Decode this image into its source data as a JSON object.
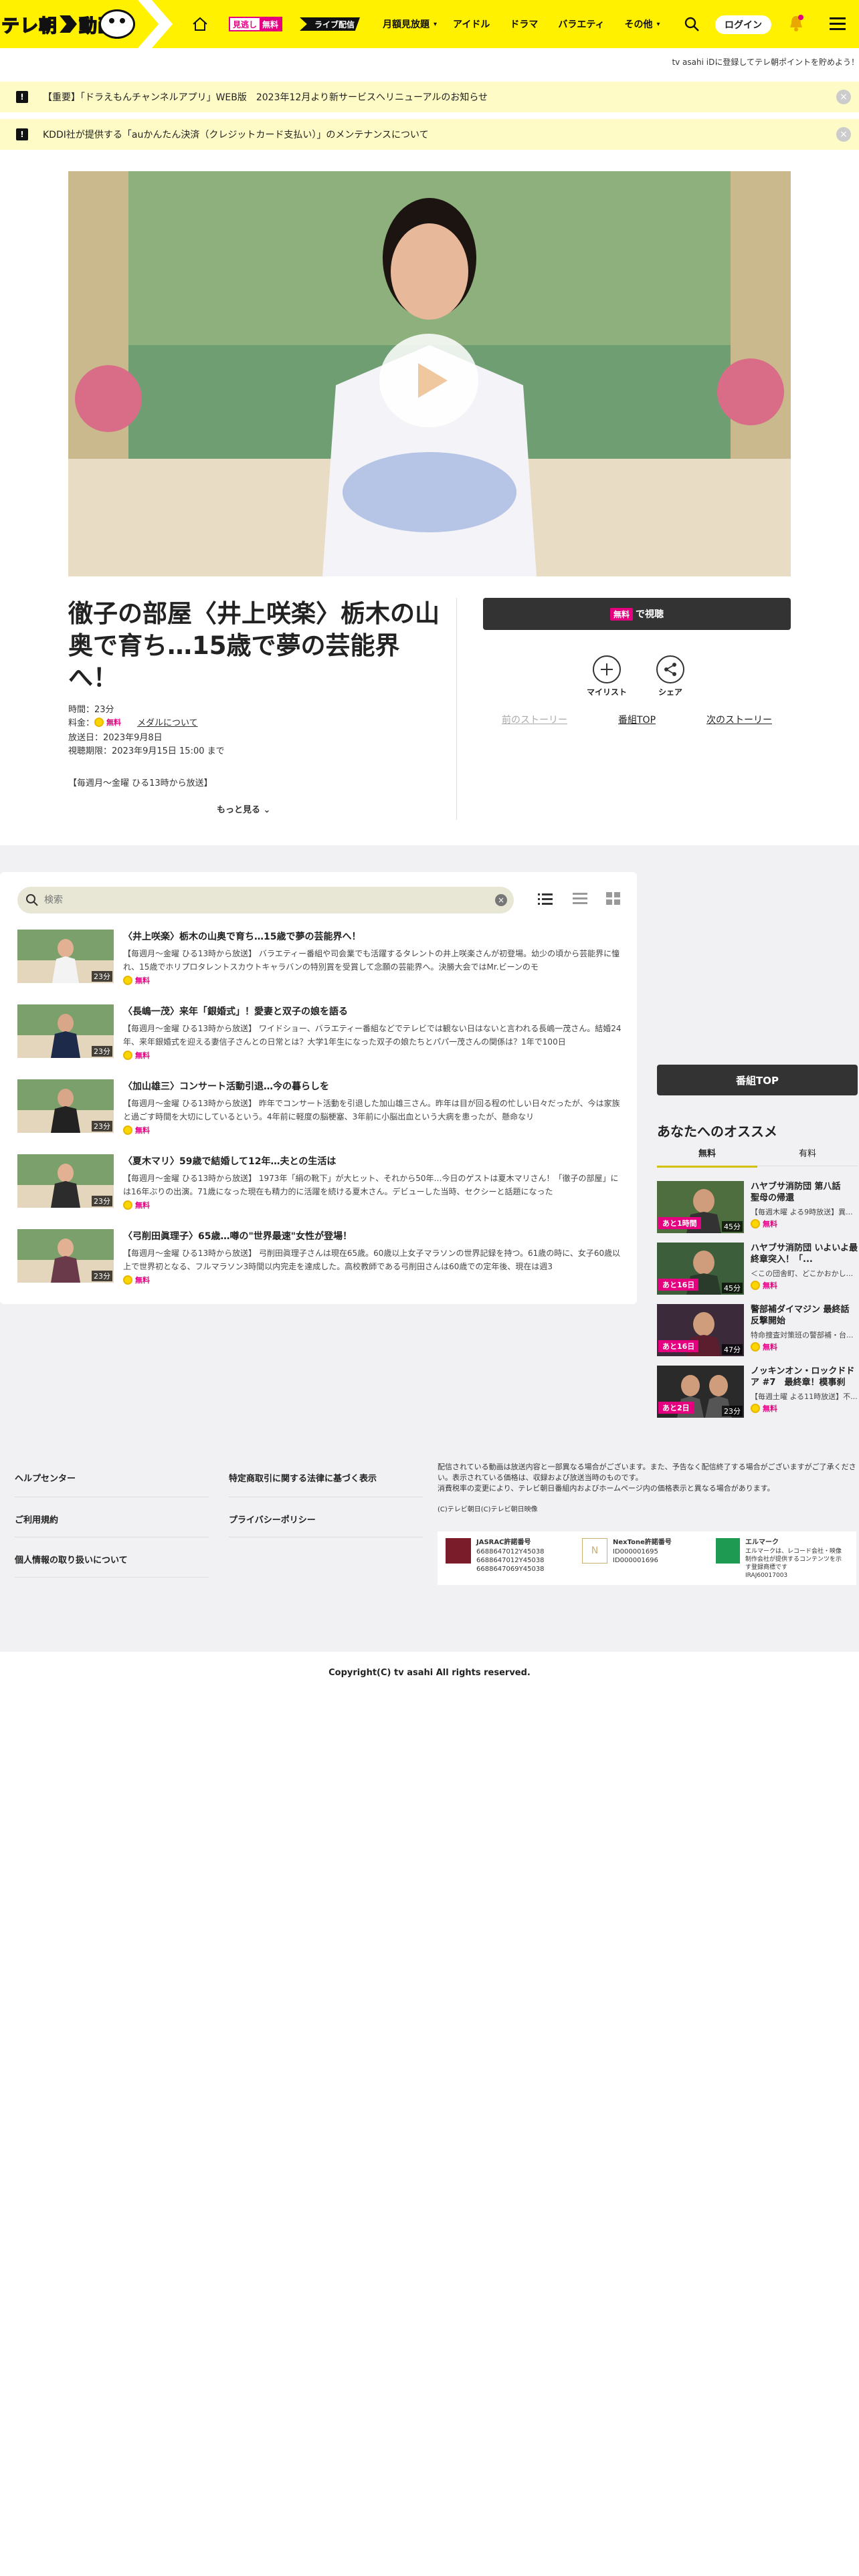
{
  "header": {
    "logo_text": "テレ朝",
    "logo_text2": "動画",
    "mi_a": "見逃し",
    "mi_b": "無料",
    "live": "ライブ配信",
    "nav": [
      "月額見放題",
      "アイドル",
      "ドラマ",
      "バラエティ",
      "その他"
    ],
    "login": "ログイン"
  },
  "promo": "tv asahi iDに登録してテレ朝ポイントを貯めよう！",
  "notices": [
    "【重要】「ドラえもんチャンネルアプリ」WEB版　2023年12月より新サービスへリニューアルのお知らせ",
    "KDDI社が提供する「auかんたん決済（クレジットカード支払い）」のメンテナンスについて"
  ],
  "program": {
    "title": "徹子の部屋〈井上咲楽〉栃木の山奥で育ち…15歳で夢の芸能界へ！",
    "time": "時間：23分",
    "fee_label": "料金：",
    "fee_free": "無料",
    "medal": "メダルについて",
    "air": "放送日：2023年9月8日",
    "deadline": "視聴期限：2023年9月15日 15:00 まで",
    "slot": "【毎週月〜金曜 ひる13時から放送】",
    "more": "もっと見る"
  },
  "actions": {
    "watch_badge": "無料",
    "watch_label": "で視聴",
    "mylist": "マイリスト",
    "share": "シェア",
    "prev": "前のストーリー",
    "top": "番組TOP",
    "next": "次のストーリー"
  },
  "search": {
    "placeholder": "検索"
  },
  "episodes": [
    {
      "title": "〈井上咲楽〉栃木の山奥で育ち…15歳で夢の芸能界へ！",
      "desc": "【毎週月〜金曜 ひる13時から放送】 バラエティー番組や司会業でも活躍するタレントの井上咲楽さんが初登場。幼少の頃から芸能界に憧れ、15歳でホリプロタレントスカウトキャラバンの特別賞を受賞して念願の芸能界へ。決勝大会ではMr.ビーンのモ",
      "dur": "23分",
      "free": "無料"
    },
    {
      "title": "〈長嶋一茂〉来年「銀婚式」！愛妻と双子の娘を語る",
      "desc": "【毎週月〜金曜 ひる13時から放送】 ワイドショー、バラエティー番組などでテレビでは観ない日はないと言われる長嶋一茂さん。結婚24年、来年銀婚式を迎える妻信子さんとの日常とは？大学1年生になった双子の娘たちとパパ一茂さんの関係は？1年で100日",
      "dur": "23分",
      "free": "無料"
    },
    {
      "title": "〈加山雄三〉コンサート活動引退…今の暮らしを",
      "desc": "【毎週月〜金曜 ひる13時から放送】 昨年でコンサート活動を引退した加山雄三さん。昨年は目が回る程の忙しい日々だったが、今は家族と過ごす時間を大切にしているという。4年前に軽度の脳梗塞、3年前に小脳出血という大病を患ったが、懸命なリ",
      "dur": "23分",
      "free": "無料"
    },
    {
      "title": "〈夏木マリ〉59歳で結婚して12年…夫との生活は",
      "desc": "【毎週月〜金曜 ひる13時から放送】 1973年「絹の靴下」が大ヒット、それから50年…今日のゲストは夏木マリさん！「徹子の部屋」には16年ぶりの出演。71歳になった現在も精力的に活躍を続ける夏木さん。デビューした当時、セクシーと話題になった",
      "dur": "23分",
      "free": "無料"
    },
    {
      "title": "〈弓削田眞理子〉65歳…噂の\"世界最速\"女性が登場！",
      "desc": "【毎週月〜金曜 ひる13時から放送】 弓削田眞理子さんは現在65歳。60歳以上女子マラソンの世界記録を持つ。61歳の時に、女子60歳以上で世界初となる、フルマラソン3時間以内完走を達成した。高校教師である弓削田さんは60歳での定年後、現在は週3",
      "dur": "23分",
      "free": "無料"
    }
  ],
  "sidebar": {
    "program_top": "番組TOP",
    "rec_heading": "あなたへのオススメ",
    "tabs": [
      "無料",
      "有料"
    ],
    "items": [
      {
        "title": "ハヤブサ消防団 第八話　聖母の帰還",
        "desc": "【毎週木曜 よる9時放送】異...",
        "tag": "あと1時間",
        "dur": "45分",
        "free": "無料"
      },
      {
        "title": "ハヤブサ消防団 いよいよ最終章突入！「...",
        "desc": "＜この団舎町、どこかおかし...",
        "tag": "あと16日",
        "dur": "45分",
        "free": "無料"
      },
      {
        "title": "警部補ダイマジン 最終話　反撃開始",
        "desc": "特命捜査対策班の警部補・台...",
        "tag": "あと16日",
        "dur": "47分",
        "free": "無料"
      },
      {
        "title": "ノッキンオン・ロックドドア #7　最終章！模事刹殺...",
        "desc": "【毎週土曜 よる11時放送】不...",
        "tag": "あと2日",
        "dur": "23分",
        "free": "無料"
      }
    ]
  },
  "footer": {
    "links_left": [
      "ヘルプセンター",
      "ご利用規約",
      "個人情報の取り扱いについて"
    ],
    "links_right": [
      "特定商取引に関する法律に基づく表示",
      "プライバシーポリシー"
    ],
    "disclaimer": "配信されている動画は放送内容と一部異なる場合がございます。また、予告なく配信終了する場合がございますがご了承ください。表示されている価格は、収録および放送当時のものです。\n消費税率の変更により、テレビ朝日番組内およびホームページ内の価格表示と異なる場合があります。",
    "copy_small": "(C)テレビ朝日(C)テレビ朝日映像",
    "licenses": [
      {
        "name": "JASRAC許諾番号",
        "nums": "6688647012Y45038\n6688647012Y45038\n6688647069Y45038"
      },
      {
        "name": "NexTone許諾番号",
        "nums": "ID000001695\nID000001696"
      },
      {
        "name": "エルマーク",
        "nums": "エルマークは、レコード会社・映像制作会社が提供するコンテンツを示す登録商標です\nIRAJ60017003"
      }
    ]
  },
  "copyright": "Copyright(C) tv asahi All rights reserved."
}
